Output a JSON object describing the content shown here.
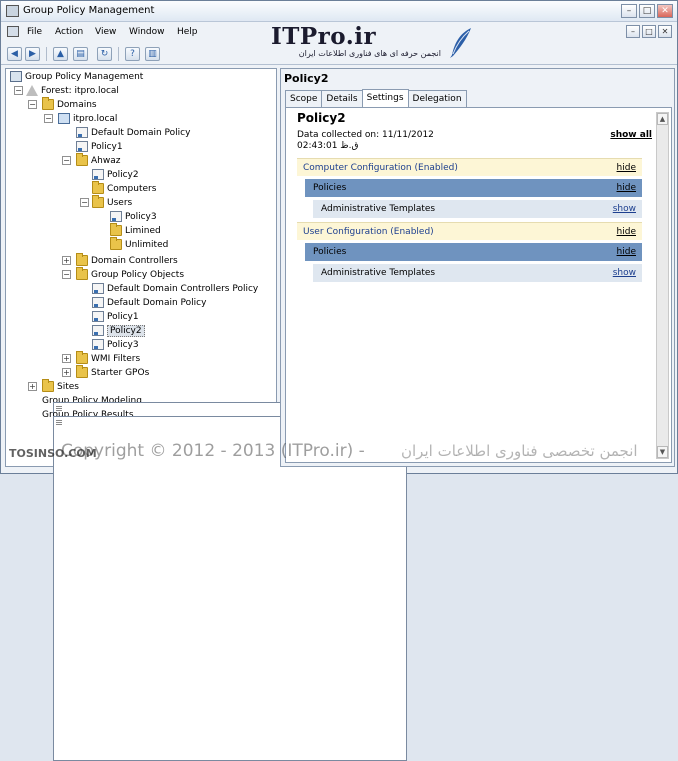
{
  "window": {
    "title": "Group Policy Management",
    "minimize": "–",
    "maximize": "□",
    "close": "✕"
  },
  "menu": [
    {
      "label": "File"
    },
    {
      "label": "Action"
    },
    {
      "label": "View"
    },
    {
      "label": "Window"
    },
    {
      "label": "Help"
    }
  ],
  "logo": {
    "brand": "ITPro.ir",
    "tagline": "انجمن حرفه ای های فناوری اطلاعات ایران"
  },
  "toolbar": {
    "back": "◀",
    "forward": "▶",
    "up": "▲",
    "console": "▤",
    "refresh": "↻",
    "help": "?",
    "properties": "▥"
  },
  "tree": {
    "root": "Group Policy Management",
    "forest": "Forest: itpro.local",
    "domains": "Domains",
    "domain": "itpro.local",
    "default_domain_policy": "Default Domain Policy",
    "policy1": "Policy1",
    "ahwaz": "Ahwaz",
    "ahwaz_policy2": "Policy2",
    "computers": "Computers",
    "users": "Users",
    "policy3": "Policy3",
    "limined": "Limined",
    "unlimited": "Unlimited",
    "domain_controllers": "Domain Controllers",
    "gpo_container": "Group Policy Objects",
    "gpo_list": [
      "Default Domain Controllers Policy",
      "Default Domain Policy",
      "Policy1",
      "Policy2",
      "Policy3"
    ],
    "wmi": "WMI Filters",
    "starter": "Starter GPOs",
    "sites": "Sites",
    "modeling": "Group Policy Modeling",
    "results": "Group Policy Results"
  },
  "right": {
    "title": "Policy2",
    "tabs": [
      "Scope",
      "Details",
      "Settings",
      "Delegation"
    ],
    "active_tab": "Settings",
    "report": {
      "name": "Policy2",
      "collected": "Data collected on: 11/11/2012",
      "time": "02:43:01 ق.ظ",
      "show_all": "show all",
      "computer_config": "Computer Configuration (Enabled)",
      "user_config": "User Configuration (Enabled)",
      "policies": "Policies",
      "admin_templates": "Administrative Templates",
      "hide": "hide",
      "show": "show"
    }
  },
  "overlay": {
    "site": "TOSINSO.COM",
    "copyright": "Copyright © 2012 - 2013 (ITPro.ir) -",
    "copyright_fa": "انجمن تخصصی فناوری اطلاعات ایران"
  },
  "colors": {
    "config_bg": "#fdf6d6",
    "policies_bg": "#6f93bf",
    "admin_bg": "#dfe7f0",
    "link": "#1d3f8f"
  }
}
